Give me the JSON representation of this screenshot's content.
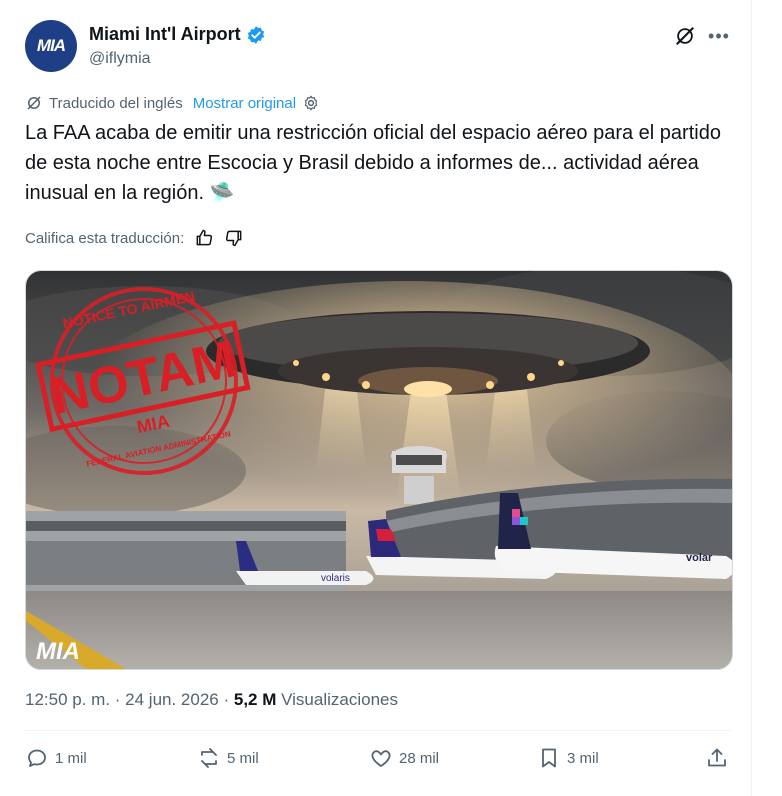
{
  "author": {
    "avatar_text": "MIA",
    "name": "Miami Int'l Airport",
    "handle": "@iflymia",
    "verified": true
  },
  "translation": {
    "label": "Traducido del inglés",
    "show_original": "Mostrar original"
  },
  "tweet": {
    "text": "La FAA acaba de emitir una restricción oficial del espacio aéreo para el partido de esta noche entre Escocia y Brasil debido a informes de... actividad aérea inusual en la región. 🛸"
  },
  "rating": {
    "label": "Califica esta traducción:"
  },
  "media": {
    "stamp_top": "NOTICE TO AIRMEN",
    "stamp_main": "NOTAM",
    "stamp_mia": "MIA",
    "stamp_bottom": "FEDERAL AVIATION ADMINISTRATION",
    "watermark": "MIA",
    "plane_label_1": "volaris",
    "plane_label_2": "volar"
  },
  "meta": {
    "timestamp": "12:50 p. m. · 24 jun. 2026 · ",
    "views_count": "5,2 M",
    "views_label": " Visualizaciones"
  },
  "actions": {
    "replies": "1 mil",
    "reposts": "5 mil",
    "likes": "28 mil",
    "bookmarks": "3 mil"
  },
  "colors": {
    "accent": "#1d9bf0",
    "verified": "#1d9bf0",
    "stamp_red": "#d81f26",
    "avatar_bg": "#1e3f86"
  }
}
